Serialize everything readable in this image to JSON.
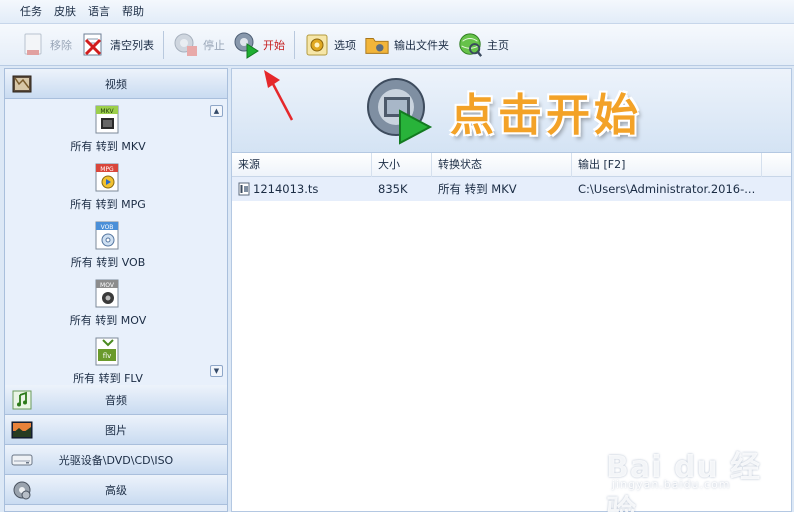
{
  "menu": {
    "items": [
      "任务",
      "皮肤",
      "语言",
      "帮助"
    ]
  },
  "toolbar": {
    "remove_label": "移除",
    "clear_label": "清空列表",
    "stop_label": "停止",
    "start_label": "开始",
    "options_label": "选项",
    "output_folder_label": "输出文件夹",
    "home_label": "主页"
  },
  "sidebar": {
    "video": {
      "label": "视频",
      "items": [
        {
          "badge": "MKV",
          "label": "所有 转到 MKV"
        },
        {
          "badge": "MPG",
          "label": "所有 转到 MPG"
        },
        {
          "badge": "VOB",
          "label": "所有 转到 VOB"
        },
        {
          "badge": "MOV",
          "label": "所有 转到 MOV"
        },
        {
          "badge": "flv",
          "label": "所有 转到 FLV"
        }
      ]
    },
    "audio_label": "音频",
    "image_label": "图片",
    "optical_label": "光驱设备\\DVD\\CD\\ISO",
    "advanced_label": "高级"
  },
  "banner": {
    "text": "点击开始"
  },
  "table": {
    "headers": [
      "来源",
      "大小",
      "转换状态",
      "输出 [F2]"
    ],
    "rows": [
      {
        "source": "1214013.ts",
        "size": "835K",
        "status": "所有 转到 MKV",
        "output": "C:\\Users\\Administrator.2016-..."
      }
    ]
  },
  "watermark": {
    "text": "Bai du 经验",
    "url": "jingyan.baidu.com"
  },
  "colors": {
    "accent_orange": "#f3a227",
    "start_red": "#c62020",
    "panel_blue": "#c9dbf1"
  }
}
